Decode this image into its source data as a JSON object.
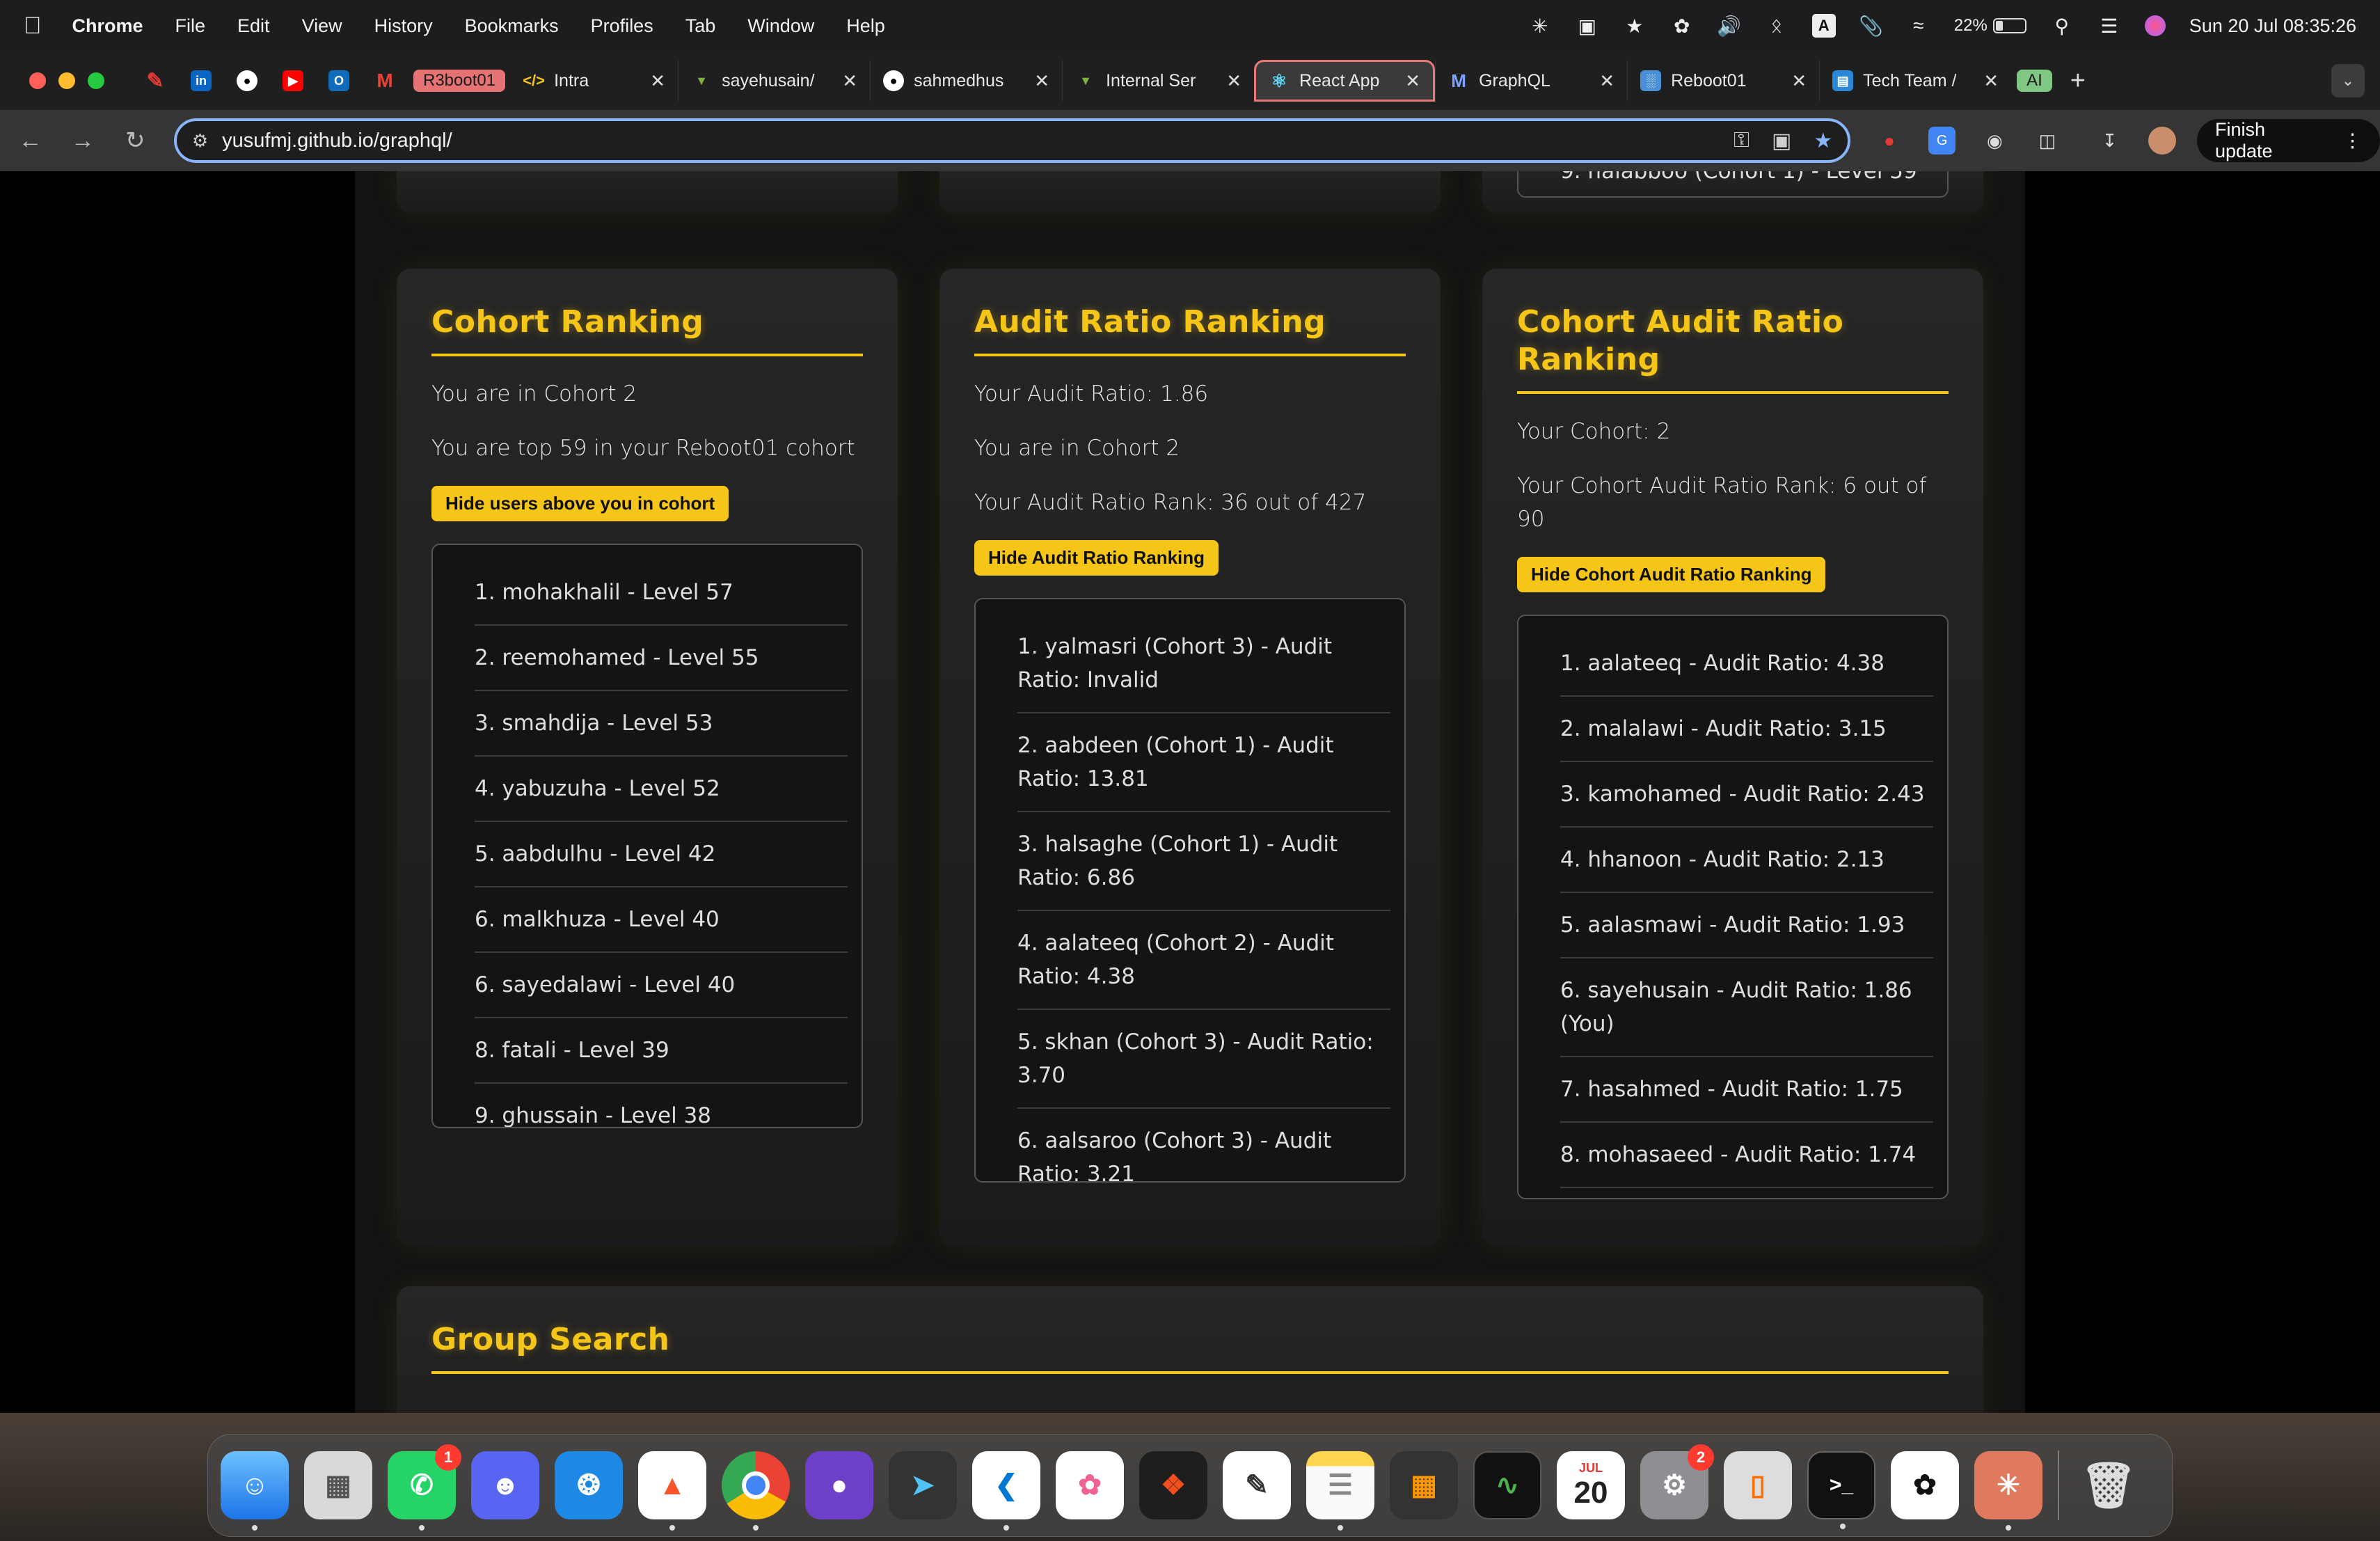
{
  "menubar": {
    "app": "Chrome",
    "items": [
      "File",
      "Edit",
      "View",
      "History",
      "Bookmarks",
      "Profiles",
      "Tab",
      "Window",
      "Help"
    ],
    "battery": "22%",
    "clock": "Sun 20 Jul  08:35:26",
    "input_source": "A"
  },
  "tabs": {
    "group_label": "R3boot01",
    "items": [
      {
        "title": "Intra"
      },
      {
        "title": "sayehusain/"
      },
      {
        "title": "sahmedhus"
      },
      {
        "title": "Internal Ser"
      },
      {
        "title": "React App"
      },
      {
        "title": "GraphQL"
      },
      {
        "title": "Reboot01"
      },
      {
        "title": "Tech Team /"
      }
    ],
    "ai_label": "AI",
    "new_tab": "+"
  },
  "toolbar": {
    "url": "yusufmj.github.io/graphql/",
    "finish_update": "Finish update"
  },
  "page": {
    "top_partial_item": "9. halabboo (Cohort 1) - Level 59",
    "cohort_ranking": {
      "title": "Cohort Ranking",
      "line1": "You are in Cohort 2",
      "line2": "You are top 59 in your Reboot01 cohort",
      "button": "Hide users above you in cohort",
      "items": [
        "1. mohakhalil - Level 57",
        "2. reemohamed - Level 55",
        "3. smahdija - Level 53",
        "4. yabuzuha - Level 52",
        "5. aabdulhu - Level 42",
        "6. malkhuza - Level 40",
        "6. sayedalawi - Level 40",
        "8. fatali - Level 39",
        "9. ghussain - Level 38"
      ]
    },
    "audit_ranking": {
      "title": "Audit Ratio Ranking",
      "line1": "Your Audit Ratio: 1.86",
      "line2": "You are in Cohort 2",
      "line3": "Your Audit Ratio Rank: 36 out of 427",
      "button": "Hide Audit Ratio Ranking",
      "items": [
        "1. yalmasri (Cohort 3) - Audit Ratio: Invalid",
        "2. aabdeen (Cohort 1) - Audit Ratio: 13.81",
        "3. halsaghe (Cohort 1) - Audit Ratio: 6.86",
        "4. aalateeq (Cohort 2) - Audit Ratio: 4.38",
        "5. skhan (Cohort 3) - Audit Ratio: 3.70",
        "6. aalsaroo (Cohort 3) - Audit Ratio: 3.21"
      ]
    },
    "cohort_audit_ranking": {
      "title": "Cohort Audit Ratio Ranking",
      "line1": "Your Cohort: 2",
      "line2": "Your Cohort Audit Ratio Rank: 6 out of 90",
      "button": "Hide Cohort Audit Ratio Ranking",
      "items": [
        "1. aalateeq - Audit Ratio: 4.38",
        "2. malalawi - Audit Ratio: 3.15",
        "3. kamohamed - Audit Ratio: 2.43",
        "4. hhanoon - Audit Ratio: 2.13",
        "5. aalasmawi - Audit Ratio: 1.93",
        "6. sayehusain - Audit Ratio: 1.86 (You)",
        "7. hasahmed - Audit Ratio: 1.75",
        "8. mohasaeed - Audit Ratio: 1.74"
      ]
    },
    "group_search": {
      "title": "Group Search"
    }
  },
  "dock": {
    "whatsapp_badge": "1",
    "calendar_month": "JUL",
    "calendar_day": "20",
    "settings_badge": "2"
  },
  "colors": {
    "accent": "#f5c518",
    "card_bg": "#222222",
    "page_bg": "#131313"
  }
}
